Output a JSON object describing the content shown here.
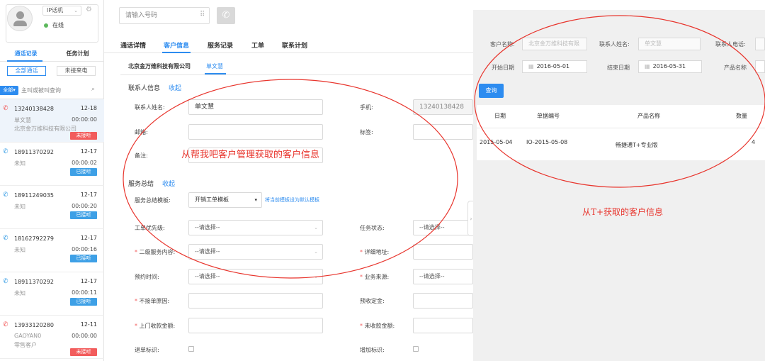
{
  "agent": {
    "phone_type": "IP话机",
    "status": "在线"
  },
  "sidebar": {
    "tabs": [
      "通话记录",
      "任务计划"
    ],
    "subtabs": [
      "全部通话",
      "未接来电"
    ],
    "filter_label": "全部",
    "search_placeholder": "主叫或被叫查询",
    "calls": [
      {
        "number": "13240138428",
        "date": "12-18",
        "name": "单文慧",
        "duration": "00:00:00",
        "company": "北京金万维科技有限公司",
        "badge": "未接听",
        "badge_color": "#f25c5c"
      },
      {
        "number": "18911370292",
        "date": "12-17",
        "name": "未知",
        "duration": "00:00:02",
        "company": "",
        "badge": "已接听",
        "badge_color": "#3ea0e6"
      },
      {
        "number": "18911249035",
        "date": "12-17",
        "name": "未知",
        "duration": "00:00:20",
        "company": "",
        "badge": "已接听",
        "badge_color": "#3ea0e6"
      },
      {
        "number": "18162792279",
        "date": "12-17",
        "name": "未知",
        "duration": "00:00:16",
        "company": "",
        "badge": "已接听",
        "badge_color": "#3ea0e6"
      },
      {
        "number": "18911370292",
        "date": "12-17",
        "name": "未知",
        "duration": "00:00:11",
        "company": "",
        "badge": "已接听",
        "badge_color": "#3ea0e6"
      },
      {
        "number": "13933120280",
        "date": "12-11",
        "name": "GAOYAN0",
        "duration": "00:00:00",
        "company": "零售客户",
        "badge": "未接听",
        "badge_color": "#f25c5c"
      }
    ]
  },
  "dialer": {
    "placeholder": "请输入号码"
  },
  "main_tabs": [
    "通话详情",
    "客户信息",
    "服务记录",
    "工单",
    "联系计划"
  ],
  "customer_tabs": {
    "company": "北京金万维科技有限公司",
    "person": "单文慧"
  },
  "contact_section": {
    "title": "联系人信息",
    "toggle": "收起",
    "name_label": "联系人姓名:",
    "name_value": "单文慧",
    "mobile_label": "手机:",
    "mobile_value": "13240138428",
    "email_label": "邮箱:",
    "tag_label": "标签:",
    "note_label": "备注:"
  },
  "service_section": {
    "title": "服务总结",
    "toggle": "收起",
    "template_label": "服务总结模板:",
    "template_value": "开销工单模板",
    "set_default_link": "将当前模板设为默认模板",
    "fields": {
      "priority_label": "工单优先级:",
      "priority_value": "--请选择--",
      "task_status_label": "任务状态:",
      "task_status_value": "--请选择--",
      "subservice_label": "二级服务内容:",
      "subservice_value": "--请选择--",
      "address_label": "详细地址:",
      "appointment_label": "预约时间:",
      "appointment_value": "--请选择--",
      "source_label": "业务来源:",
      "source_value": "--请选择--",
      "no_order_label": "不接单原因:",
      "deposit_label": "预收定金:",
      "onsite_label": "上门收款金额:",
      "unpaid_label": "未收款金额:",
      "refund_label": "退单标识:",
      "supplement_label": "增加标识:"
    }
  },
  "annotations": {
    "left": "从帮我吧客户管理获取的客户信息",
    "right": "从T+获取的客户信息"
  },
  "tplus_panel": {
    "customer_name_label": "客户名称:",
    "customer_name_value": "北京金万维科技有限",
    "contact_name_label": "联系人姓名:",
    "contact_name_value": "单文慧",
    "contact_phone_label": "联系人电话:",
    "start_date_label": "开始日期",
    "start_date_value": "2016-05-01",
    "end_date_label": "结束日期",
    "end_date_value": "2016-05-31",
    "product_name_label": "产品名称",
    "query_button": "查询",
    "table": {
      "headers": [
        "日期",
        "单据编号",
        "产品名称",
        "数量"
      ],
      "rows": [
        [
          "2015-05-04",
          "IO-2015-05-08",
          "畅捷通T+专业版",
          "4"
        ]
      ]
    }
  },
  "colors": {
    "accent": "#2d8cf0",
    "annotation": "#e8342c",
    "missed": "#f25c5c",
    "answered": "#3ea0e6"
  }
}
